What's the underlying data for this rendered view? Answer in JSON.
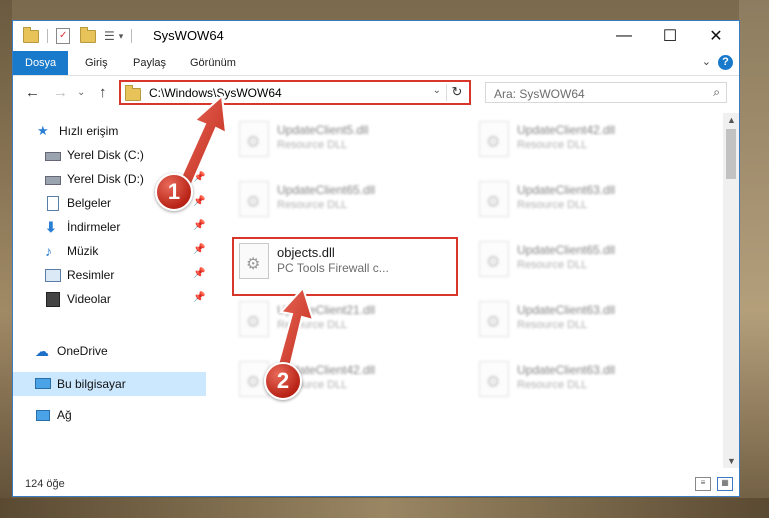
{
  "window": {
    "title": "SysWOW64",
    "controls": {
      "minimize": "—",
      "maximize": "☐",
      "close": "✕"
    }
  },
  "ribbon": {
    "tabs": [
      {
        "label": "Dosya",
        "active": true
      },
      {
        "label": "Giriş"
      },
      {
        "label": "Paylaş"
      },
      {
        "label": "Görünüm"
      }
    ],
    "help": "?"
  },
  "nav": {
    "back": "←",
    "forward": "→",
    "dropdown": "⌄",
    "up": "↑",
    "address": "C:\\Windows\\SysWOW64",
    "refresh": "↻"
  },
  "search": {
    "placeholder": "Ara: SysWOW64",
    "icon": "search-icon"
  },
  "sidebar": {
    "items": [
      {
        "label": "Hızlı erişim",
        "icon": "star-icon"
      },
      {
        "label": "Yerel Disk (C:)",
        "icon": "drive-icon",
        "pinned": true
      },
      {
        "label": "Yerel Disk (D:)",
        "icon": "drive-icon",
        "pinned": true
      },
      {
        "label": "Belgeler",
        "icon": "documents-icon",
        "pinned": true
      },
      {
        "label": "İndirmeler",
        "icon": "download-icon",
        "pinned": true
      },
      {
        "label": "Müzik",
        "icon": "music-icon",
        "pinned": true
      },
      {
        "label": "Resimler",
        "icon": "pictures-icon",
        "pinned": true
      },
      {
        "label": "Videolar",
        "icon": "videos-icon",
        "pinned": true
      },
      {
        "label": "OneDrive",
        "icon": "cloud-icon"
      },
      {
        "label": "Bu bilgisayar",
        "icon": "computer-icon",
        "selected": true
      },
      {
        "label": "Ağ",
        "icon": "network-icon"
      }
    ],
    "pin_glyph": "📌"
  },
  "files": [
    {
      "name": "UpdateClient5.dll",
      "desc": "Resource DLL"
    },
    {
      "name": "UpdateClient42.dll",
      "desc": "Resource DLL"
    },
    {
      "name": "UpdateClient65.dll",
      "desc": "Resource DLL"
    },
    {
      "name": "UpdateClient63.dll",
      "desc": "Resource DLL"
    },
    {
      "name": "objects.dll",
      "desc": "PC Tools Firewall c..."
    },
    {
      "name": "UpdateClient65.dll",
      "desc": "Resource DLL"
    },
    {
      "name": "UpdateClient21.dll",
      "desc": "Resource DLL"
    },
    {
      "name": "UpdateClient63.dll",
      "desc": "Resource DLL"
    },
    {
      "name": "UpdateClient42.dll",
      "desc": "Resource DLL"
    },
    {
      "name": "UpdateClient63.dll",
      "desc": "Resource DLL"
    }
  ],
  "status": {
    "count": "124 öğe"
  },
  "callouts": [
    "1",
    "2"
  ],
  "colors": {
    "accent": "#1979ca",
    "highlight": "#d9362b",
    "selection": "#cce8ff"
  }
}
